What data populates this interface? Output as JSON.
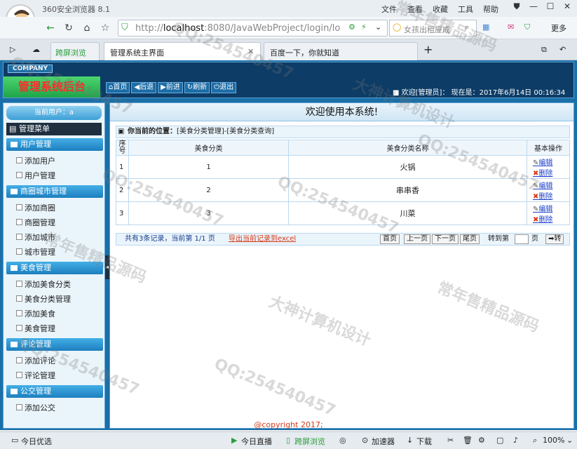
{
  "browser": {
    "title": "360安全浏览器 8.1",
    "menu": [
      "文件",
      "查看",
      "收藏",
      "工具",
      "帮助"
    ],
    "url_host": "localhost",
    "url_rest": ":8080/JavaWebProject/login/lo",
    "url_prefix": "http://",
    "search_placeholder": "女孩出租屋成",
    "more": "更多",
    "tabs": [
      {
        "label": "跨屏浏览"
      },
      {
        "label": "管理系统主界面"
      },
      {
        "label": "百度一下，你就知道"
      }
    ]
  },
  "app": {
    "company": "COMPANY",
    "system_title": "管理系统后台",
    "toolbar": [
      "首页",
      "后退",
      "前进",
      "刷新",
      "退出"
    ],
    "welcome_user": "欢迎[管理员]：",
    "now_label": "现在是：2017年6月14日 00:16:34",
    "current_user": "当前用户：a",
    "menu_title": "管理菜单",
    "groups": [
      {
        "title": "用户管理",
        "items": [
          "添加用户",
          "用户管理"
        ]
      },
      {
        "title": "商圈城市管理",
        "items": [
          "添加商圈",
          "商圈管理",
          "添加城市",
          "城市管理"
        ]
      },
      {
        "title": "美食管理",
        "items": [
          "添加美食分类",
          "美食分类管理",
          "添加美食",
          "美食管理"
        ]
      },
      {
        "title": "评论管理",
        "items": [
          "添加评论",
          "评论管理"
        ]
      },
      {
        "title": "公交管理",
        "items": [
          "添加公交"
        ]
      }
    ],
    "welcome_banner": "欢迎使用本系统!",
    "location_label": "你当前的位置：",
    "location_path": "[美食分类管理]-[美食分类查询]",
    "table": {
      "headers": [
        "序号",
        "美食分类",
        "美食分类名称",
        "基本操作"
      ],
      "rows": [
        {
          "no": "1",
          "id": "1",
          "name": "火锅"
        },
        {
          "no": "2",
          "id": "2",
          "name": "串串香"
        },
        {
          "no": "3",
          "id": "3",
          "name": "川菜"
        }
      ],
      "edit": "编辑",
      "delete": "删除"
    },
    "pager": {
      "summary": "共有3条记录，当前第 1/1 页",
      "export": "导出当前记录到excel",
      "first": "首页",
      "prev": "上一页",
      "next": "下一页",
      "last": "尾页",
      "goto": "转到第",
      "page": "页",
      "go": "转"
    },
    "copyright": "@copyright 2017;"
  },
  "status": {
    "left": "今日优选",
    "live": "今日直播",
    "cross": "跨屏浏览",
    "accel": "加速器",
    "download": "下载",
    "zoom": "100%"
  },
  "watermark": [
    "QQ:254540457",
    "大神计算机设计",
    "常年售精品源码"
  ]
}
